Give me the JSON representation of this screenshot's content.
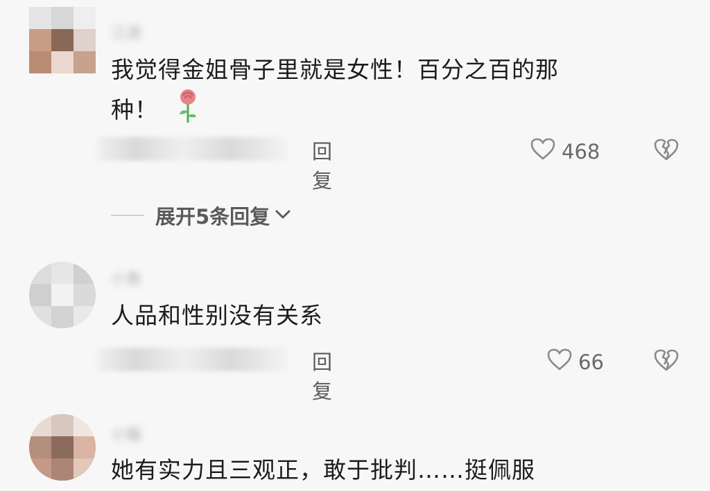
{
  "comments": [
    {
      "username": "江淑",
      "text_line1": "我觉得金姐骨子里就是女性！百分之百的那",
      "text_line2": "种！",
      "emoji": "rose-icon",
      "meta": "昨天 湖北",
      "reply_label": "回复",
      "likes": "468"
    },
    {
      "username": "小鱼",
      "text_line1": "人品和性别没有关系",
      "meta": "昨天 北京",
      "reply_label": "回复",
      "likes": "66"
    },
    {
      "username": "小猫",
      "text_line1": "她有实力且三观正，敢于批判……挺佩服"
    }
  ],
  "expand_replies": {
    "label": "展开5条回复"
  },
  "colors": {
    "background": "#f7f7f7",
    "text_primary": "#1c1c1c",
    "text_secondary": "#5a5a5a",
    "rose": "#e8838a",
    "stem": "#4caf50"
  }
}
